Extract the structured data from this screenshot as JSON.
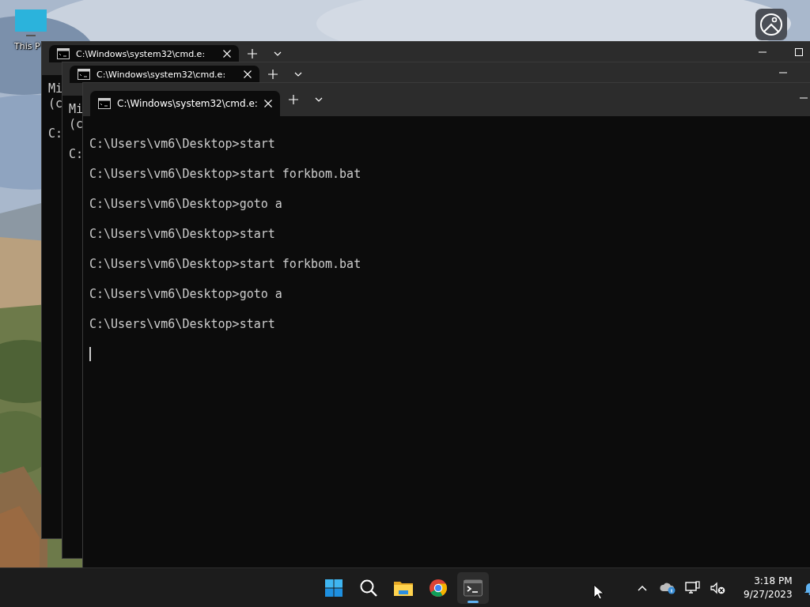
{
  "desktop": {
    "icons": [
      {
        "label": "This P"
      }
    ]
  },
  "windows": [
    {
      "tab_title": "C:\\Windows\\system32\\cmd.e:",
      "banner": [
        "Mi",
        "(c"
      ],
      "commands": [
        "C:"
      ]
    },
    {
      "tab_title": "C:\\Windows\\system32\\cmd.e:",
      "banner": [
        "Mi",
        "(c"
      ],
      "commands": [
        "C:"
      ]
    },
    {
      "tab_title": "C:\\Windows\\system32\\cmd.e:",
      "commands": [
        "C:\\Users\\vm6\\Desktop>start",
        "C:\\Users\\vm6\\Desktop>start forkbom.bat",
        "C:\\Users\\vm6\\Desktop>goto a",
        "C:\\Users\\vm6\\Desktop>start",
        "C:\\Users\\vm6\\Desktop>start forkbom.bat",
        "C:\\Users\\vm6\\Desktop>goto a",
        "C:\\Users\\vm6\\Desktop>start"
      ],
      "cursor": true
    }
  ],
  "taskbar": {
    "apps": [
      {
        "kind": "start",
        "selected": false
      },
      {
        "kind": "search",
        "selected": false
      },
      {
        "kind": "folder",
        "selected": false
      },
      {
        "kind": "browser",
        "selected": false
      },
      {
        "kind": "terminal",
        "selected": true
      }
    ],
    "tray": [
      {
        "kind": "chevron"
      },
      {
        "kind": "cloud"
      },
      {
        "kind": "network"
      },
      {
        "kind": "volume-muted"
      }
    ],
    "clock": {
      "time": "3:18 PM",
      "date": "9/27/2023"
    }
  }
}
